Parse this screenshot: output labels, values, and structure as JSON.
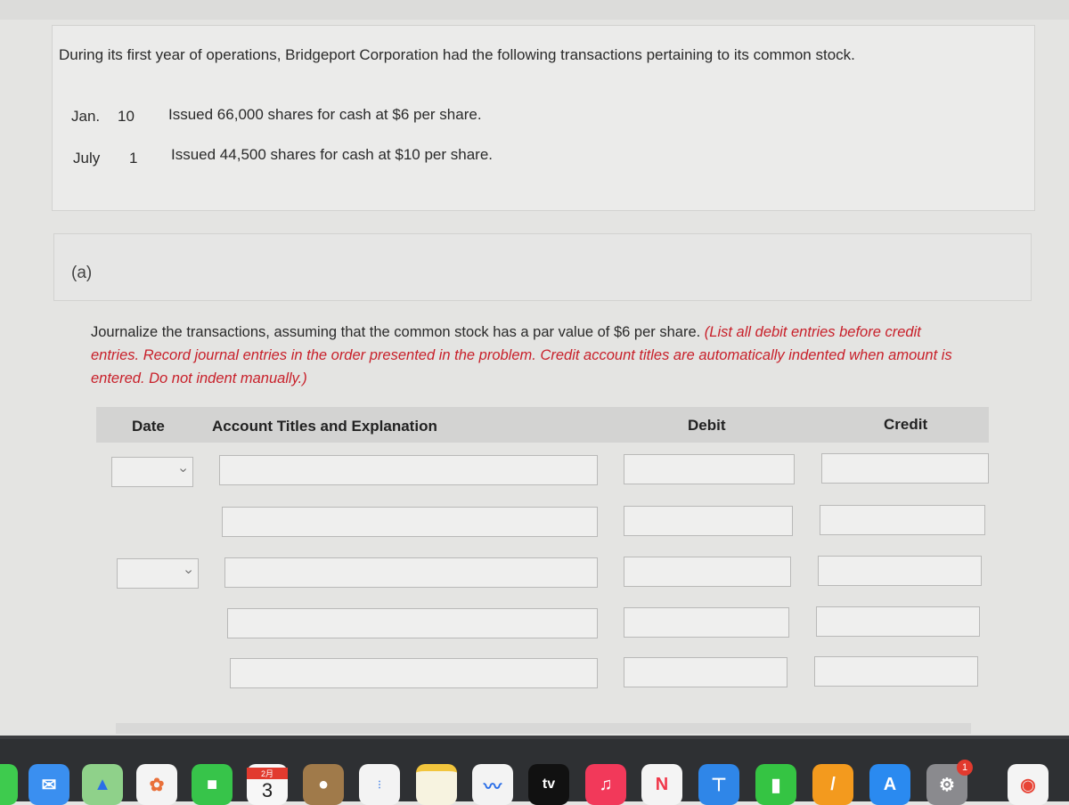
{
  "problem": {
    "intro": "During its first year of operations, Bridgeport Corporation had the following transactions pertaining to its common stock.",
    "transactions": [
      {
        "month": "Jan.",
        "day": "10",
        "text": "Issued 66,000 shares for cash at $6 per share."
      },
      {
        "month": "July",
        "day": "1",
        "text": "Issued 44,500 shares for cash at $10 per share."
      }
    ]
  },
  "part": {
    "label": "(a)",
    "instruction": "Journalize the transactions, assuming that the common stock has a par value of $6 per share.",
    "instruction_red": "(List all debit entries before credit entries. Record journal entries in the order presented in the problem. Credit account titles are automatically indented when amount is entered. Do not indent manually.)"
  },
  "table": {
    "headers": {
      "date": "Date",
      "account": "Account Titles and Explanation",
      "debit": "Debit",
      "credit": "Credit"
    },
    "rows": [
      {
        "date": "",
        "account": "",
        "debit": "",
        "credit": ""
      },
      {
        "account": "",
        "debit": "",
        "credit": ""
      },
      {
        "date": "",
        "account": "",
        "debit": "",
        "credit": ""
      },
      {
        "account": "",
        "debit": "",
        "credit": ""
      },
      {
        "account": "",
        "debit": "",
        "credit": ""
      }
    ]
  },
  "dock": {
    "calendar_month": "2月",
    "calendar_day": "3",
    "tv_label": "tv",
    "settings_badge": "1",
    "apps": [
      "messages",
      "mail",
      "maps",
      "photos",
      "facetime",
      "calendar",
      "contacts",
      "reminders",
      "notes",
      "freeform",
      "tv",
      "music",
      "news",
      "keynote",
      "numbers",
      "pages",
      "app-store",
      "system-settings",
      "chrome"
    ]
  }
}
